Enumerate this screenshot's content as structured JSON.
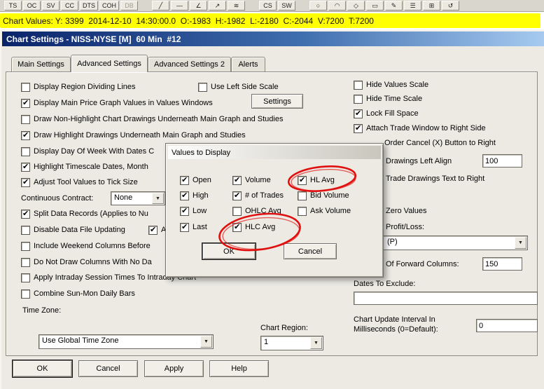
{
  "colors": {
    "titlebar_start": "#0a246a",
    "titlebar_end": "#a6caf0",
    "highlight": "#ffff00",
    "annotation": "#e01010",
    "dialog_bg": "#eceae3"
  },
  "toolbar": {
    "items": [
      {
        "label": "TS"
      },
      {
        "label": "OC"
      },
      {
        "label": "SV"
      },
      {
        "label": "CC"
      },
      {
        "label": "DTS"
      },
      {
        "label": "COH"
      },
      {
        "label": "DB",
        "disabled": true
      },
      {
        "label": "╱"
      },
      {
        "label": "—"
      },
      {
        "label": "∠"
      },
      {
        "label": "↗"
      },
      {
        "label": "≋"
      },
      {
        "label": "CS"
      },
      {
        "label": "SW"
      },
      {
        "label": "○"
      },
      {
        "label": "◠"
      },
      {
        "label": "◇"
      },
      {
        "label": "▭"
      },
      {
        "label": "✎"
      },
      {
        "label": "☰"
      },
      {
        "label": "⊞"
      },
      {
        "label": "↺"
      }
    ]
  },
  "chart_values": {
    "text": "Chart Values: Y: 3399  2014-12-10  14:30:00.0  O:-1983  H:-1982  L:-2180  C:-2044  V:7200  T:7200"
  },
  "dialog": {
    "title": "Chart Settings - NISS-NYSE [M]  60 Min  #12",
    "tabs": [
      {
        "label": "Main Settings"
      },
      {
        "label": "Advanced Settings"
      },
      {
        "label": "Advanced Settings 2"
      },
      {
        "label": "Alerts"
      }
    ],
    "left": {
      "checks": [
        {
          "label": "Display Region Dividing Lines",
          "checked": false
        },
        {
          "label": "Display Main Price Graph Values in Values Windows",
          "checked": true
        },
        {
          "label": "Draw Non-Highlight Chart Drawings Underneath Main Graph and Studies",
          "checked": false
        },
        {
          "label": "Draw Highlight Drawings Underneath Main Graph and Studies",
          "checked": true
        },
        {
          "label": "Display Day Of Week With Dates C",
          "checked": false
        },
        {
          "label": "Highlight Timescale Dates, Month",
          "checked": true
        },
        {
          "label": "Adjust Tool Values to Tick Size",
          "checked": true
        },
        {
          "label": "Split Data Records (Applies to Nu",
          "checked": true
        },
        {
          "label": "Disable Data File Updating",
          "checked": false
        },
        {
          "label": "A",
          "checked": true
        },
        {
          "label": "Include Weekend Columns Before",
          "checked": false
        },
        {
          "label": "Do Not Draw Columns With No Da",
          "checked": false
        },
        {
          "label": "Apply Intraday Session Times To Intraday Chart",
          "checked": false
        },
        {
          "label": "Combine Sun-Mon Daily Bars",
          "checked": false
        }
      ],
      "continuous_contract_label": "Continuous Contract:",
      "continuous_contract_value": "None",
      "time_zone_label": "Time Zone:",
      "time_zone_value": "Use Global Time Zone"
    },
    "middle": {
      "use_left_side_scale": {
        "label": "Use Left Side Scale",
        "checked": false
      },
      "settings_button": "Settings"
    },
    "right": {
      "checks": [
        {
          "label": "Hide Values Scale",
          "checked": false
        },
        {
          "label": "Hide Time Scale",
          "checked": false
        },
        {
          "label": "Lock Fill Space",
          "checked": true
        },
        {
          "label": "Attach Trade Window to Right Side",
          "checked": true
        }
      ],
      "fragments": [
        "Order Cancel (X) Button to Right",
        "Drawings Left Align",
        "Trade Drawings Text to Right",
        "Zero Values",
        "Profit/Loss:",
        "Of Forward Columns:"
      ],
      "drawings_left_align_value": "100",
      "pl_value": "(P)",
      "forward_columns_value": "150",
      "dates_to_exclude_label": "Dates To Exclude:",
      "dates_to_exclude_value": "",
      "update_interval_line1": "Chart Update Interval In",
      "update_interval_line2": "Milliseconds (0=Default):",
      "update_interval_value": "0"
    },
    "chart_region_label": "Chart Region:",
    "chart_region_value": "1",
    "buttons": [
      {
        "label": "OK"
      },
      {
        "label": "Cancel"
      },
      {
        "label": "Apply"
      },
      {
        "label": "Help"
      }
    ]
  },
  "popup": {
    "title": "Values to Display",
    "checks": [
      {
        "label": "Open",
        "checked": true
      },
      {
        "label": "Volume",
        "checked": true
      },
      {
        "label": "HL Avg",
        "checked": true
      },
      {
        "label": "High",
        "checked": true
      },
      {
        "label": "# of Trades",
        "checked": true
      },
      {
        "label": "Bid Volume",
        "checked": false
      },
      {
        "label": "Low",
        "checked": true
      },
      {
        "label": "OHLC Avg",
        "checked": false
      },
      {
        "label": "Ask Volume",
        "checked": false
      },
      {
        "label": "Last",
        "checked": true
      },
      {
        "label": "HLC Avg",
        "checked": true
      }
    ],
    "ok_label": "OK",
    "cancel_label": "Cancel"
  }
}
